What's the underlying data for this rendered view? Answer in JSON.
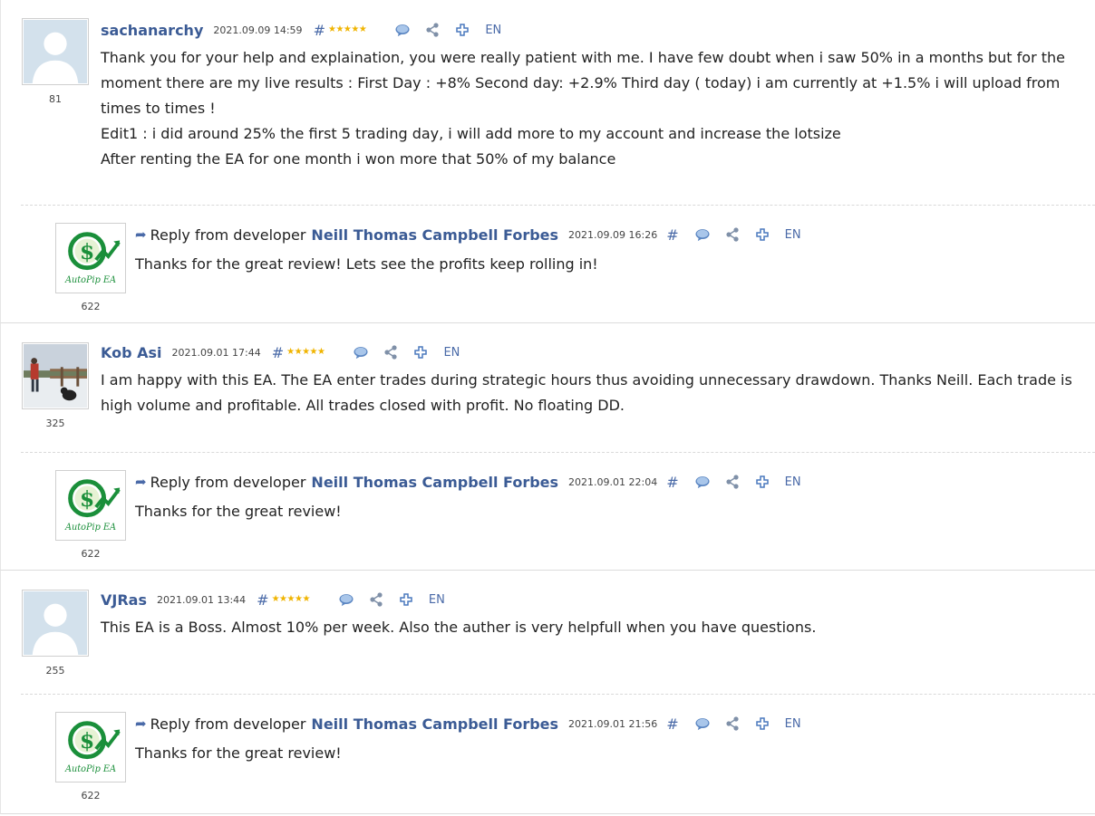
{
  "reviews": [
    {
      "author": "sachanarchy",
      "date": "2021.09.09 14:59",
      "hash": "#",
      "stars": 5,
      "lang": "EN",
      "rating_count": "81",
      "avatar": "default-user",
      "lines": [
        "Thank you for your help and explaination, you were really patient with me. I have few doubt when i saw 50% in a months but for the moment there are my live results : First Day : +8% Second day: +2.9% Third day ( today) i am currently at +1.5% i will upload from times to times !",
        "Edit1 : i did around 25% the first 5 trading day, i will add more to my account and increase the lotsize",
        "After renting the EA for one month i won more that 50% of my balance"
      ],
      "reply": {
        "prefix": "Reply from developer",
        "author": "Neill Thomas Campbell Forbes",
        "date": "2021.09.09 16:26",
        "hash": "#",
        "lang": "EN",
        "rating_count": "622",
        "logo_text": "AutoPip EA",
        "text": "Thanks for the great review! Lets see the profits keep rolling in!"
      }
    },
    {
      "author": "Kob Asi",
      "date": "2021.09.01 17:44",
      "hash": "#",
      "stars": 5,
      "lang": "EN",
      "rating_count": "325",
      "avatar": "photo",
      "lines": [
        "I am happy with this EA. The EA enter trades during strategic hours thus avoiding unnecessary drawdown. Thanks Neill. Each trade is high volume and profitable. All trades closed with profit. No floating DD."
      ],
      "reply": {
        "prefix": "Reply from developer",
        "author": "Neill Thomas Campbell Forbes",
        "date": "2021.09.01 22:04",
        "hash": "#",
        "lang": "EN",
        "rating_count": "622",
        "logo_text": "AutoPip EA",
        "text": "Thanks for the great review!"
      }
    },
    {
      "author": "VJRas",
      "date": "2021.09.01 13:44",
      "hash": "#",
      "stars": 5,
      "lang": "EN",
      "rating_count": "255",
      "avatar": "default-user",
      "lines": [
        "This EA is a Boss. Almost 10% per week. Also the auther is very helpfull when you have questions."
      ],
      "reply": {
        "prefix": "Reply from developer",
        "author": "Neill Thomas Campbell Forbes",
        "date": "2021.09.01 21:56",
        "hash": "#",
        "lang": "EN",
        "rating_count": "622",
        "logo_text": "AutoPip EA",
        "text": "Thanks for the great review!"
      }
    }
  ],
  "icons": {
    "comment": "speech-bubble-icon",
    "share": "share-icon",
    "add": "plus-icon",
    "reply": "reply-arrow-icon",
    "star": "star-icon"
  },
  "colors": {
    "link": "#3b5b95",
    "star": "#f0b400",
    "logo_green": "#1a8f3a",
    "logo_gold": "#d8a400"
  }
}
